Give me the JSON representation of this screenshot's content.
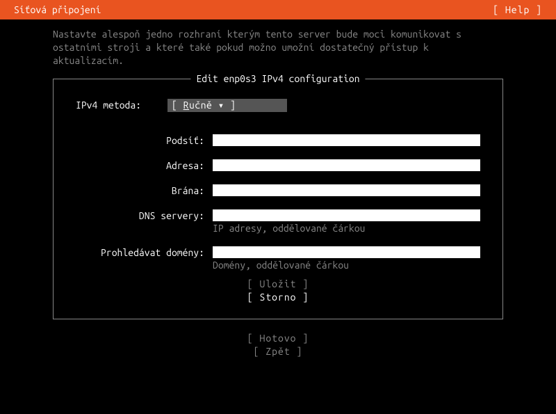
{
  "header": {
    "title": "Síťová připojení",
    "help": "[ Help ]"
  },
  "instructions": "Nastavte alespoň jedno rozhraní kterým tento server bude moci komunikovat s ostatními stroji a které také pokud možno umožní dostatečný přístup k aktualizacím.",
  "dialog": {
    "title": "Edit enp0s3 IPv4 configuration",
    "method_label": "IPv4 metoda:",
    "method_value_prefix": "[ ",
    "method_value_letter": "R",
    "method_value_rest": "učně",
    "method_value_suffix": "        ▾ ]",
    "fields": {
      "subnet": {
        "label": "Podsíť:",
        "value": ""
      },
      "address": {
        "label": "Adresa:",
        "value": ""
      },
      "gateway": {
        "label": "Brána:",
        "value": ""
      },
      "dns": {
        "label": "DNS servery:",
        "value": "",
        "hint": "IP adresy, oddělované čárkou"
      },
      "search": {
        "label": "Prohledávat domény:",
        "value": "",
        "hint": "Domény, oddělované čárkou"
      }
    },
    "buttons": {
      "save": "[ Uložit    ]",
      "cancel": "[ Storno    ]"
    }
  },
  "footer": {
    "done": "[ Hotovo    ]",
    "back": "[ Zpět      ]"
  }
}
